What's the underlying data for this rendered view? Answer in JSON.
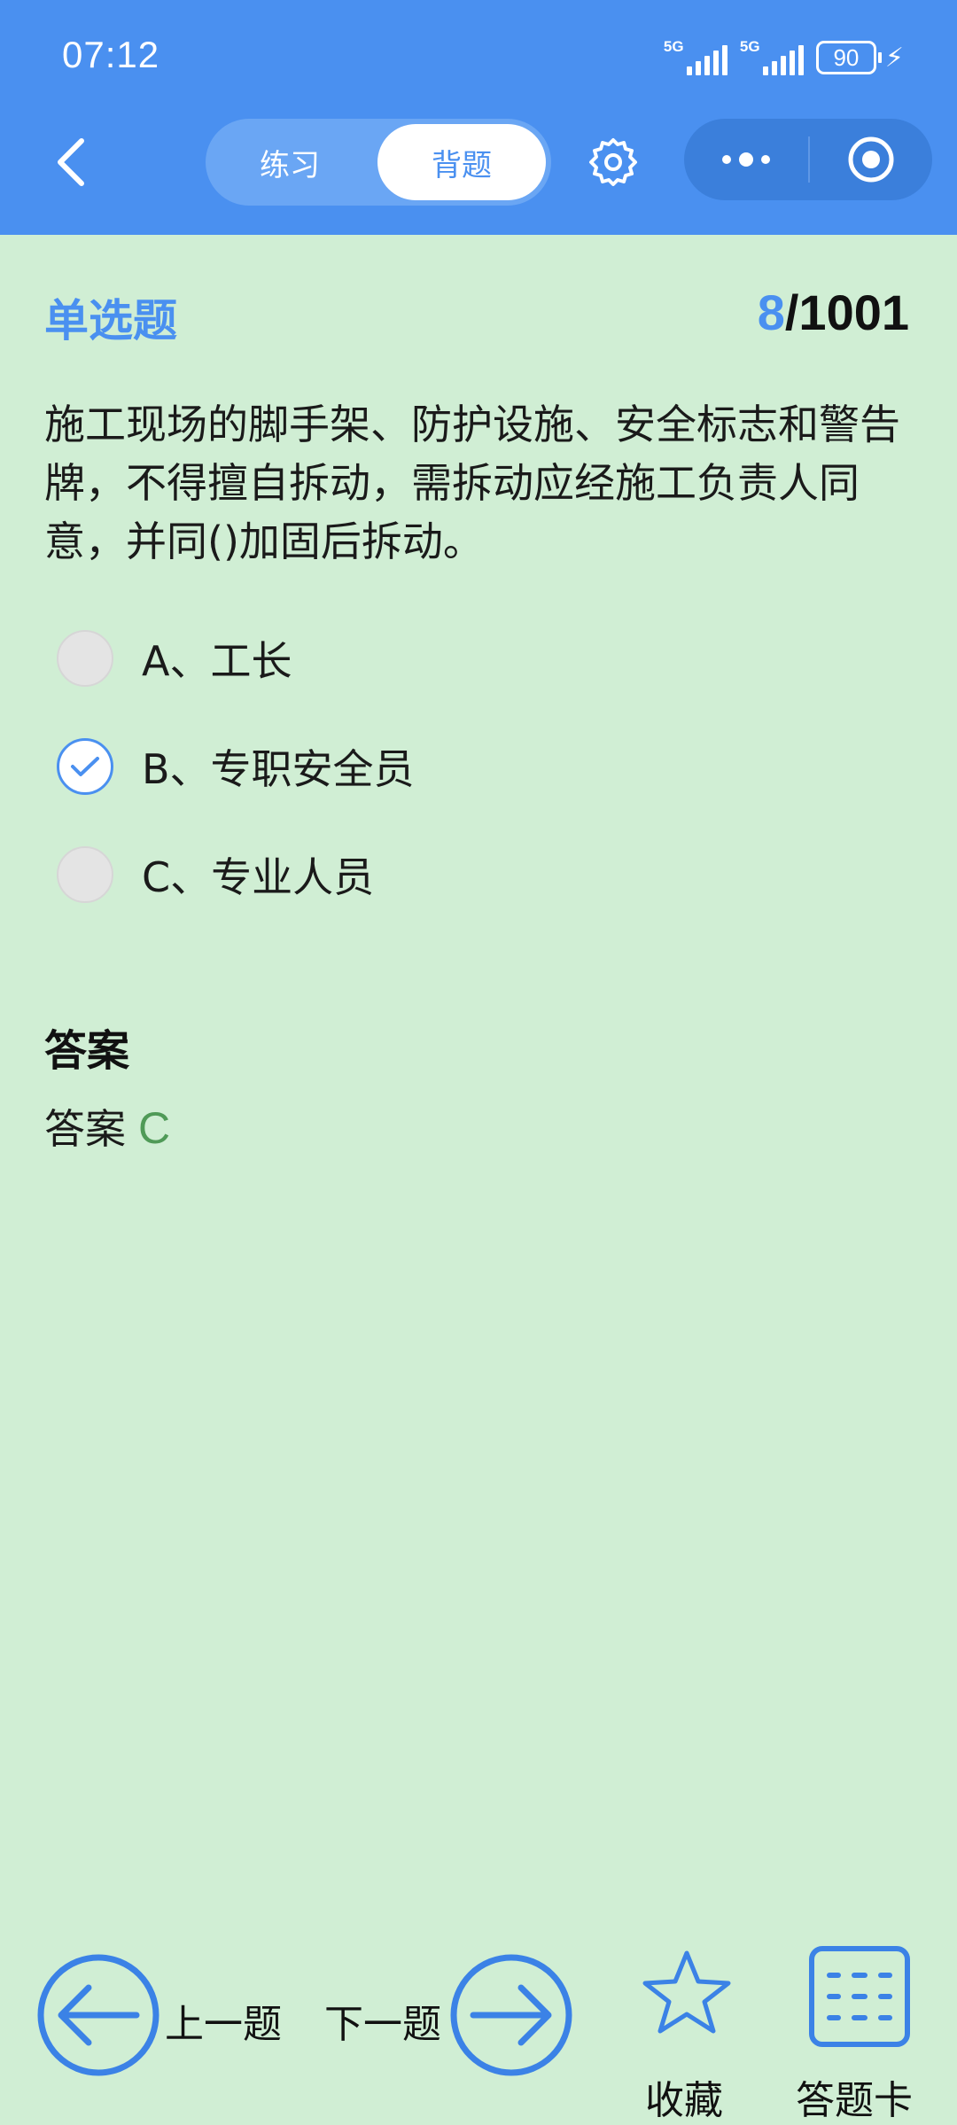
{
  "status_bar": {
    "time": "07:12",
    "signal1_tag": "5G",
    "signal2_tag": "5G",
    "battery": "90"
  },
  "nav": {
    "tab_practice": "练习",
    "tab_memorize": "背题",
    "selected_tab": "背题"
  },
  "question": {
    "type": "单选题",
    "current": "8",
    "total": "/1001",
    "text": "施工现场的脚手架、防护设施、安全标志和警告牌，不得擅自拆动，需拆动应经施工负责人同意，并同()加固后拆动。",
    "options": [
      {
        "label": "A、工长",
        "checked": false
      },
      {
        "label": "B、专职安全员",
        "checked": true
      },
      {
        "label": "C、专业人员",
        "checked": false
      }
    ]
  },
  "answer": {
    "heading": "答案",
    "prefix": "答案",
    "value": "C"
  },
  "bottom": {
    "prev": "上一题",
    "next": "下一题",
    "favorite": "收藏",
    "answer_card": "答题卡"
  },
  "colors": {
    "header": "#4a90f0",
    "background": "#d0eed4",
    "accent": "#4a90f0",
    "answer": "#4f9a57"
  }
}
